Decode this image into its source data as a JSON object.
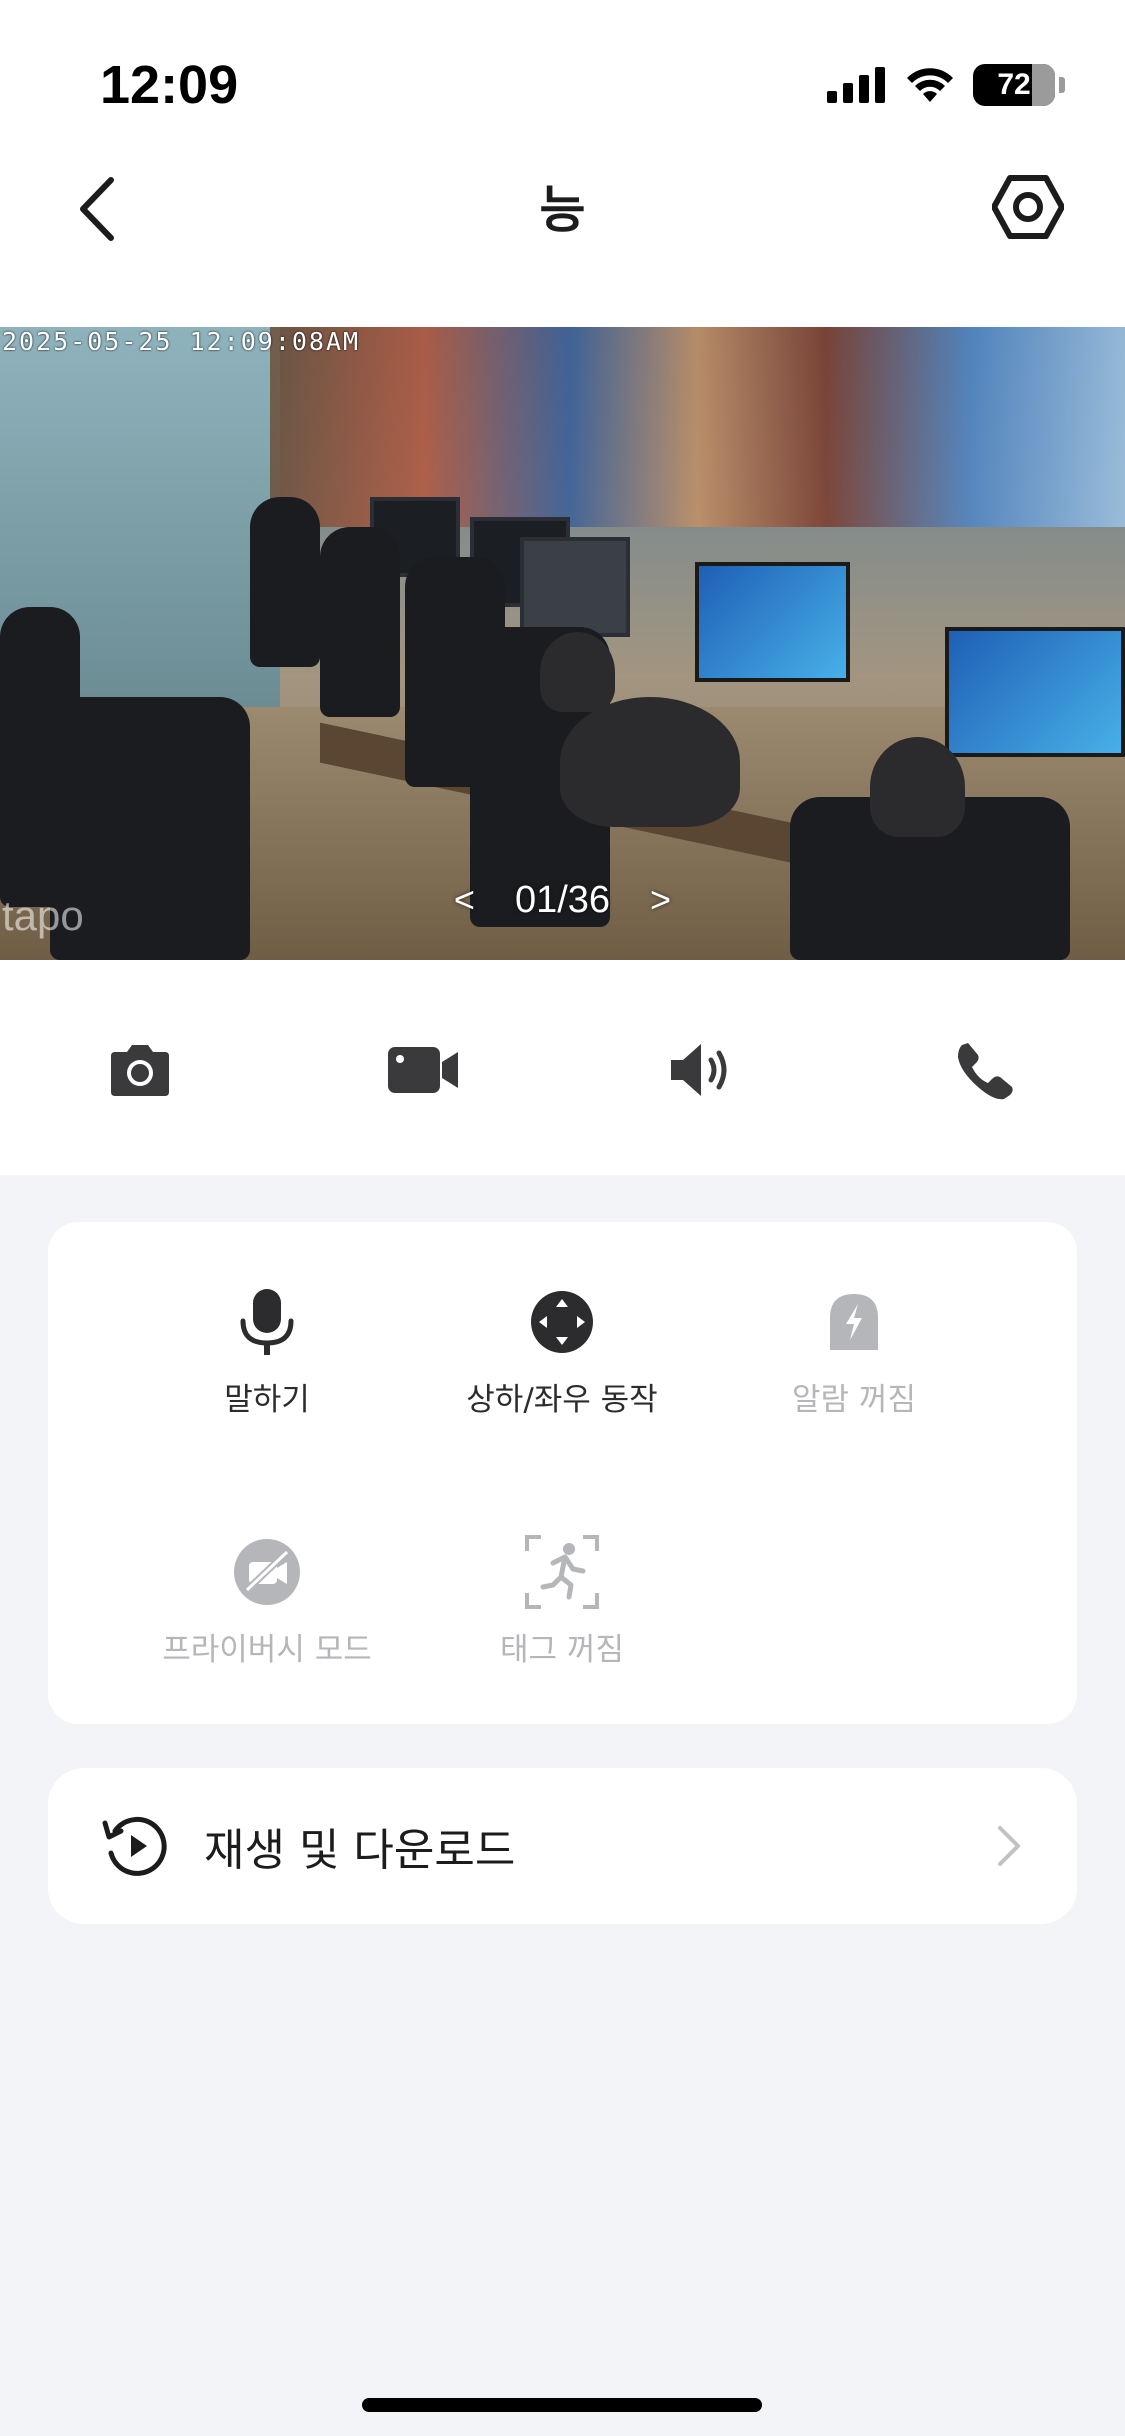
{
  "status_bar": {
    "time": "12:09",
    "battery_level": "72",
    "battery_percent": 72
  },
  "nav": {
    "title": "능",
    "back_icon": "chevron-left-icon",
    "settings_icon": "hexagon-gear-icon"
  },
  "video": {
    "timestamp": "2025-05-25  12:09:08AM",
    "watermark": "tapo",
    "pager": {
      "prev": "<",
      "current": "01/36",
      "next": ">"
    }
  },
  "actions": [
    {
      "icon": "camera-icon"
    },
    {
      "icon": "video-record-icon"
    },
    {
      "icon": "speaker-icon"
    },
    {
      "icon": "phone-icon"
    }
  ],
  "controls": {
    "talk": {
      "label": "말하기",
      "icon": "microphone-icon",
      "enabled": true
    },
    "pan_tilt": {
      "label": "상하/좌우 동작",
      "icon": "pan-tilt-icon",
      "enabled": true
    },
    "alarm": {
      "label": "알람 꺼짐",
      "icon": "alarm-icon",
      "enabled": false
    },
    "privacy": {
      "label": "프라이버시 모드",
      "icon": "privacy-camera-off-icon",
      "enabled": false
    },
    "tag": {
      "label": "태그 꺼짐",
      "icon": "motion-tag-icon",
      "enabled": false
    }
  },
  "playback": {
    "label": "재생 및 다운로드",
    "icon": "history-play-icon",
    "chevron": "chevron-right-icon"
  },
  "colors": {
    "background": "#f3f4f8",
    "card": "#ffffff",
    "icon_active": "#2c2c2e",
    "icon_disabled": "#b5b6ba"
  }
}
